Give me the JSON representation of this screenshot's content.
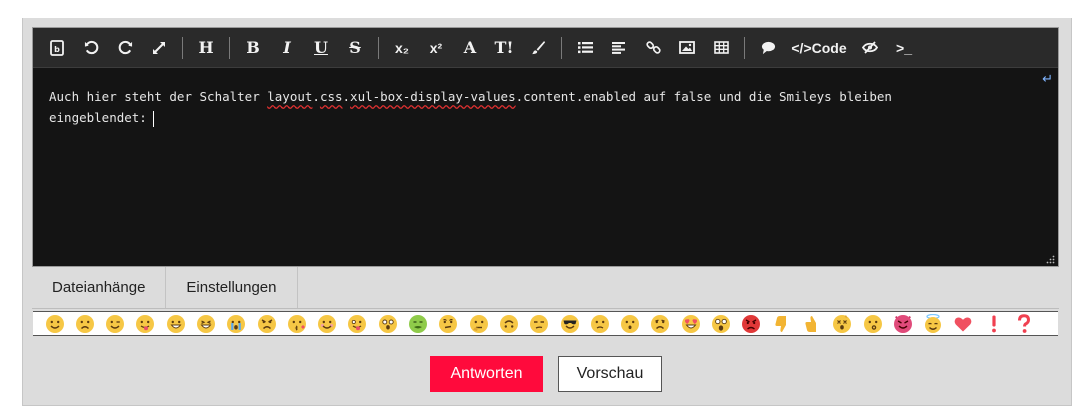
{
  "toolbar": {
    "heading_label": "H",
    "bold_label": "B",
    "italic_label": "I",
    "underline_label": "U",
    "strike_label": "S",
    "subscript_label": "x₂",
    "superscript_label": "x²",
    "font_label": "A",
    "textsize_label": "T!",
    "code_label": "</>Code",
    "terminal_label": ">_"
  },
  "editor": {
    "text_before": "Auch hier steht der Schalter ",
    "seg1": "layout",
    "dot1": ".",
    "seg2": "css",
    "dot2": ".",
    "seg3": "xul-box-display-values",
    "text_after": ".content.enabled auf false und die Smileys bleiben",
    "line2": "eingeblendet:"
  },
  "tabs": {
    "attachments": "Dateianhänge",
    "settings": "Einstellungen"
  },
  "smileys": [
    "smile",
    "frown",
    "wink",
    "tongue",
    "grin",
    "big-grin",
    "crying",
    "angry",
    "kiss",
    "blush",
    "silly",
    "surprised",
    "sick",
    "confused",
    "thinking",
    "upside-down",
    "unamused",
    "cool",
    "worried",
    "hushed",
    "sad",
    "heart-eyes",
    "astonished",
    "mad",
    "thumbs-down",
    "thumbs-up",
    "dizzy",
    "whistle",
    "devil",
    "angel",
    "heart",
    "exclamation",
    "question"
  ],
  "buttons": {
    "reply": "Antworten",
    "preview": "Vorschau"
  },
  "colors": {
    "primary": "#ff0a3c",
    "editor_bg": "#141414",
    "toolbar_bg": "#2a2a2a",
    "emoji_yellow": "#f6c745",
    "emoji_red": "#f05060"
  }
}
